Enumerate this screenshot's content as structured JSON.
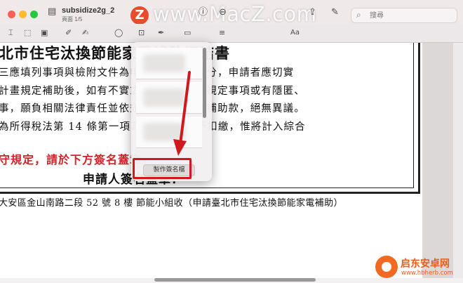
{
  "window": {
    "title": "subsidize2g_2",
    "subtitle": "頁面 1/5",
    "watermark_text": "www.MacZ.com",
    "logo_letter": "Z"
  },
  "search": {
    "placeholder": "搜尋"
  },
  "colors": {
    "accent_red": "#d0181f",
    "logo_orange": "#e94b2c",
    "toolbar_bg": "#efe9ea"
  },
  "toolbar": {
    "icons": [
      "sidebar-icon",
      "info-icon",
      "zoom-out-icon",
      "zoom-in-icon",
      "share-icon",
      "pen-icon",
      "rotate-icon",
      "markup-icon"
    ],
    "row2_icons": [
      "text-selection-icon",
      "rect-selection-icon",
      "sketch-icon",
      "draw-icon",
      "shapes-icon",
      "text-box-icon",
      "sign-icon",
      "note-icon",
      "line-style-icon",
      "border-color-icon",
      "fill-color-icon",
      "text-style-icon"
    ],
    "text_style_label": "Aa"
  },
  "document": {
    "title": "北市住宅汰換節能家電補助切結書",
    "lines": [
      "三應填列事項與檢附文件為申請要件之一部分，申請者應切實",
      "計畫規定補助後，如有不實或有違反本計畫規定事項或有隱匿、",
      "事，願負相關法律責任並依規定，繳回全部補助款，絕無異議。",
      "為所得稅法第 14 條第一項其他所得，免予扣繳，惟將計入綜合"
    ],
    "red_line": "守規定，請於下方簽名蓋章。",
    "sign_label": "申請人簽名蓋章：",
    "address": "大安區金山南路二段 52 號 8 樓  節能小組收（申請臺北市住宅汰換節能家電補助）"
  },
  "popover": {
    "make_signature_label": "製作簽名檔"
  },
  "brand": {
    "name": "启东安卓网",
    "url": "www.hbherb.com"
  }
}
